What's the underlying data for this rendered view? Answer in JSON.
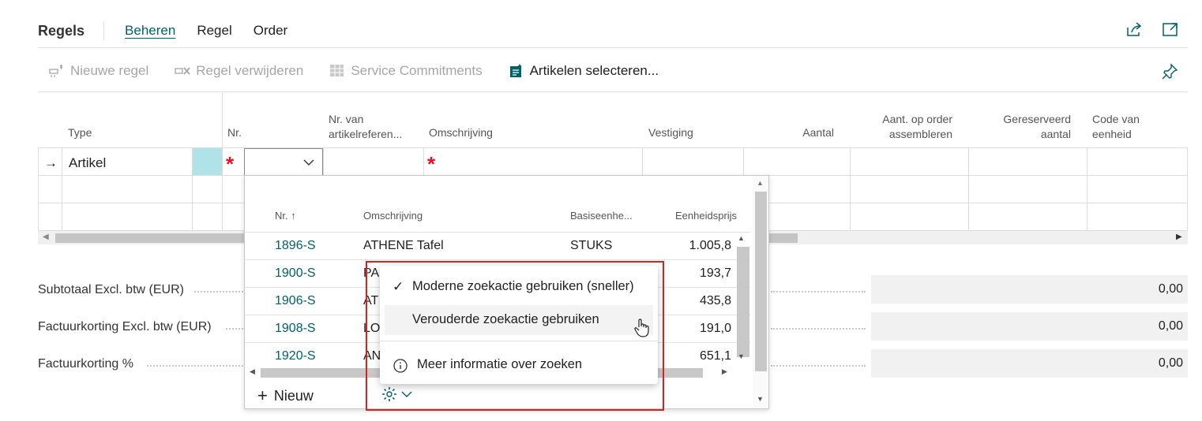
{
  "header": {
    "title": "Regels",
    "tabs": [
      {
        "label": "Beheren",
        "active": true
      },
      {
        "label": "Regel",
        "active": false
      },
      {
        "label": "Order",
        "active": false
      }
    ],
    "icons": [
      "share-icon",
      "expand-icon"
    ]
  },
  "toolbar": {
    "new_line": "Nieuwe regel",
    "delete_line": "Regel verwijderen",
    "service_commitments": "Service Commitments",
    "select_items": "Artikelen selecteren...",
    "pin_icon": "pin-icon"
  },
  "grid": {
    "columns": {
      "type": "Type",
      "no": "Nr.",
      "ref_line1": "Nr. van",
      "ref_line2": "artikelreferen...",
      "description": "Omschrijving",
      "location": "Vestiging",
      "quantity": "Aantal",
      "assemble_line1": "Aant. op order",
      "assemble_line2": "assembleren",
      "reserved_line1": "Gereserveerd",
      "reserved_line2": "aantal",
      "uom_line1": "Code van",
      "uom_line2": "eenheid"
    },
    "rows": [
      {
        "type": "Artikel",
        "required_mark": "*"
      }
    ],
    "row_indicator": "→"
  },
  "totals": [
    {
      "label": "Subtotaal Excl. btw (EUR)",
      "value": "0,00"
    },
    {
      "label": "Factuurkorting Excl. btw (EUR)",
      "value": "0,00"
    },
    {
      "label": "Factuurkorting %",
      "value": "0,00"
    }
  ],
  "lookup": {
    "columns": {
      "no": "Nr. ↑",
      "description": "Omschrijving",
      "base_unit": "Basiseenhe...",
      "unit_price": "Eenheidsprijs"
    },
    "rows": [
      {
        "no": "1896-S",
        "description": "ATHENE Tafel",
        "unit": "STUKS",
        "price": "1.005,8"
      },
      {
        "no": "1900-S",
        "description": "PA",
        "unit": "",
        "price": "193,7"
      },
      {
        "no": "1906-S",
        "description": "AT",
        "unit": "",
        "price": "435,8"
      },
      {
        "no": "1908-S",
        "description": "LO",
        "unit": "",
        "price": "191,0"
      },
      {
        "no": "1920-S",
        "description": "AN",
        "unit": "",
        "price": "651,1"
      }
    ],
    "new_label": "Nieuw"
  },
  "search_menu": {
    "items": [
      {
        "label": "Moderne zoekactie gebruiken (sneller)",
        "checked": true
      },
      {
        "label": "Verouderde zoekactie gebruiken",
        "checked": false
      },
      {
        "label": "Meer informatie over zoeken",
        "info": true
      }
    ]
  },
  "colors": {
    "accent": "#00616a",
    "required": "#e81123",
    "highlight_box": "#d9211d",
    "selected_cell": "#b0e3e8"
  }
}
